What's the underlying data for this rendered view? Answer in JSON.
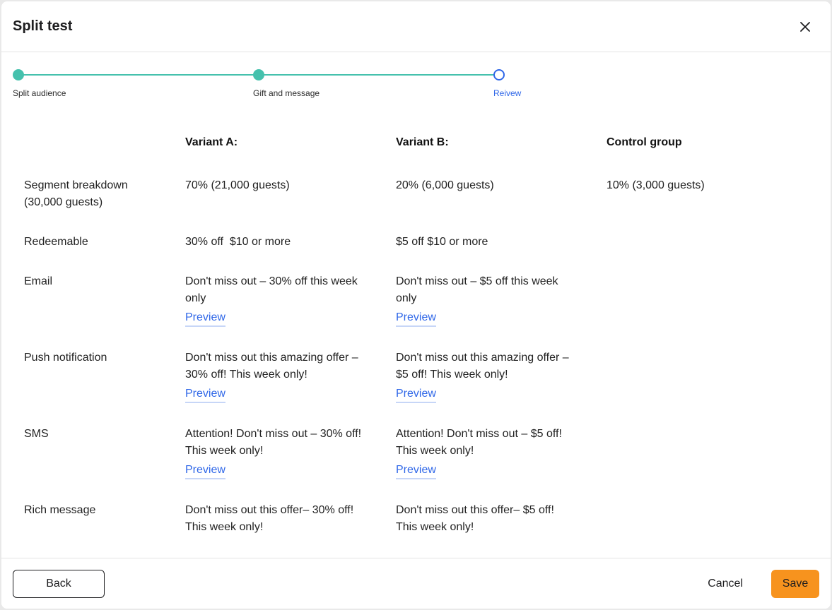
{
  "dialog": {
    "title": "Split test",
    "close_icon": "close-icon"
  },
  "stepper": {
    "steps": [
      {
        "label": "Split audience",
        "state": "done"
      },
      {
        "label": "Gift and message",
        "state": "done"
      },
      {
        "label": "Reivew",
        "state": "current"
      }
    ],
    "colors": {
      "done": "#45c1ad",
      "current": "#2f67e8"
    }
  },
  "table": {
    "columns": [
      "Variant A:",
      "Variant B:",
      "Control group"
    ],
    "rows": [
      {
        "label": "Segment breakdown (30,000 guests)",
        "a": "70% (21,000 guests)",
        "b": "20% (6,000 guests)",
        "control": "10% (3,000 guests)"
      },
      {
        "label": "Redeemable",
        "a": "30% off  $10 or more",
        "b": "$5 off $10 or more",
        "control": ""
      },
      {
        "label": "Email",
        "a": "Don't miss out –  30% off this week only",
        "b": "Don't miss out –  $5 off this week only",
        "control": "",
        "a_link": "Preview",
        "b_link": "Preview"
      },
      {
        "label": "Push notification",
        "a": "Don't miss out this amazing offer –  30% off! This week only!",
        "b": "Don't miss out this amazing offer –  $5 off! This week only!",
        "control": "",
        "a_link": "Preview",
        "b_link": "Preview"
      },
      {
        "label": "SMS",
        "a": "Attention! Don't miss out –  30% off! This week only!",
        "b": "Attention! Don't miss out –  $5 off! This week only!",
        "control": "",
        "a_link": "Preview",
        "b_link": "Preview"
      },
      {
        "label": "Rich message",
        "a": "Don't miss out this offer–  30% off! This week only!",
        "b": "Don't miss out this offer–  $5 off! This week only!",
        "control": ""
      }
    ]
  },
  "footer": {
    "back_label": "Back",
    "cancel_label": "Cancel",
    "save_label": "Save",
    "save_color": "#f7931e"
  }
}
